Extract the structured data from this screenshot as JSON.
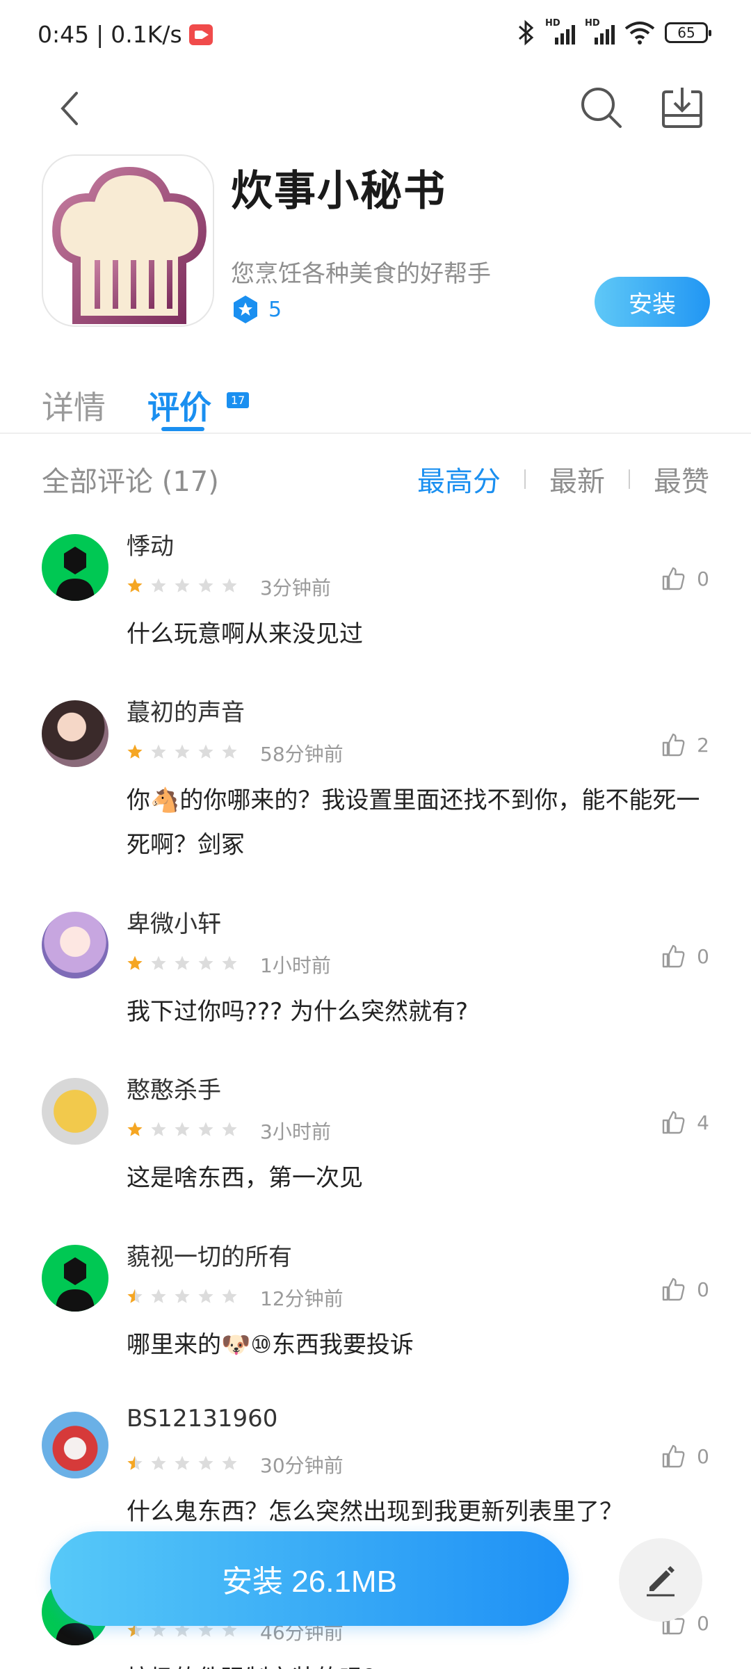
{
  "status_bar": {
    "time": "0:45",
    "separator": "|",
    "net_speed": "0.1K/s",
    "battery": "65",
    "sim1_label": "HD",
    "sim2_label": "HD"
  },
  "nav": {
    "back_icon": "back-arrow-icon",
    "search_icon": "search-icon",
    "download_icon": "download-icon"
  },
  "app": {
    "name": "炊事小秘书",
    "description": "您烹饪各种美食的好帮手",
    "rating": "5",
    "install_label": "安装"
  },
  "tabs": {
    "details": "详情",
    "reviews": "评价",
    "reviews_badge": "17"
  },
  "filter": {
    "all_comments": "全部评论 (17)",
    "sort_top": "最高分",
    "sort_newest": "最新",
    "sort_liked": "最赞"
  },
  "reviews": [
    {
      "name": "悸动",
      "time": "3分钟前",
      "likes": "0",
      "text": "什么玩意啊从来没见过",
      "stars": 1
    },
    {
      "name": "蕞初的声音",
      "time": "58分钟前",
      "likes": "2",
      "text": "你🐴的你哪来的？我设置里面还找不到你，能不能死一死啊？剑冢",
      "stars": 1
    },
    {
      "name": "卑微小轩",
      "time": "1小时前",
      "likes": "0",
      "text": "我下过你吗??? 为什么突然就有?",
      "stars": 1
    },
    {
      "name": "憨憨杀手",
      "time": "3小时前",
      "likes": "4",
      "text": "这是啥东西，第一次见",
      "stars": 1
    },
    {
      "name": "藐视一切的所有",
      "time": "12分钟前",
      "likes": "0",
      "text": "哪里来的🐶⑩东西我要投诉",
      "stars": 0.5
    },
    {
      "name": "BS12131960",
      "time": "30分钟前",
      "likes": "0",
      "text": "什么鬼东西？怎么突然出现到我更新列表里了？",
      "stars": 0.5
    },
    {
      "name": "",
      "time": "46分钟前",
      "likes": "0",
      "text": "垃圾软件强制安装的吗？",
      "stars": 0.5
    }
  ],
  "bottom": {
    "install_label": "安装 26.1MB",
    "write_icon": "pen-write-icon"
  },
  "colors": {
    "accent": "#1a8ff0",
    "star_active": "#f5a623",
    "star_inactive": "#dcdcdc"
  }
}
